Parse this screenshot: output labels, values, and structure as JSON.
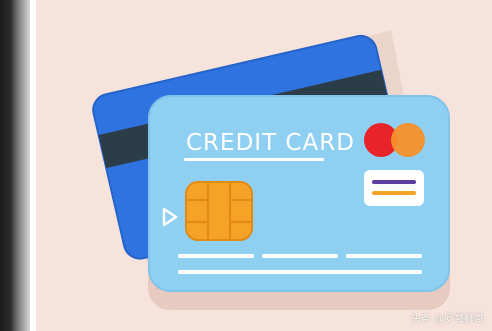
{
  "card": {
    "label": "CREDIT CARD"
  },
  "watermark": {
    "text": "头条 @罗哥狮哥"
  },
  "colors": {
    "background": "#f6e3dc",
    "shadow": "#e8cfc6",
    "back_card": "#2f73e0",
    "stripe": "#2c3d4a",
    "front_card": "#8fcff2",
    "chip": "#f5a327",
    "circle_red": "#e8232a",
    "circle_orange": "#f5902b"
  }
}
